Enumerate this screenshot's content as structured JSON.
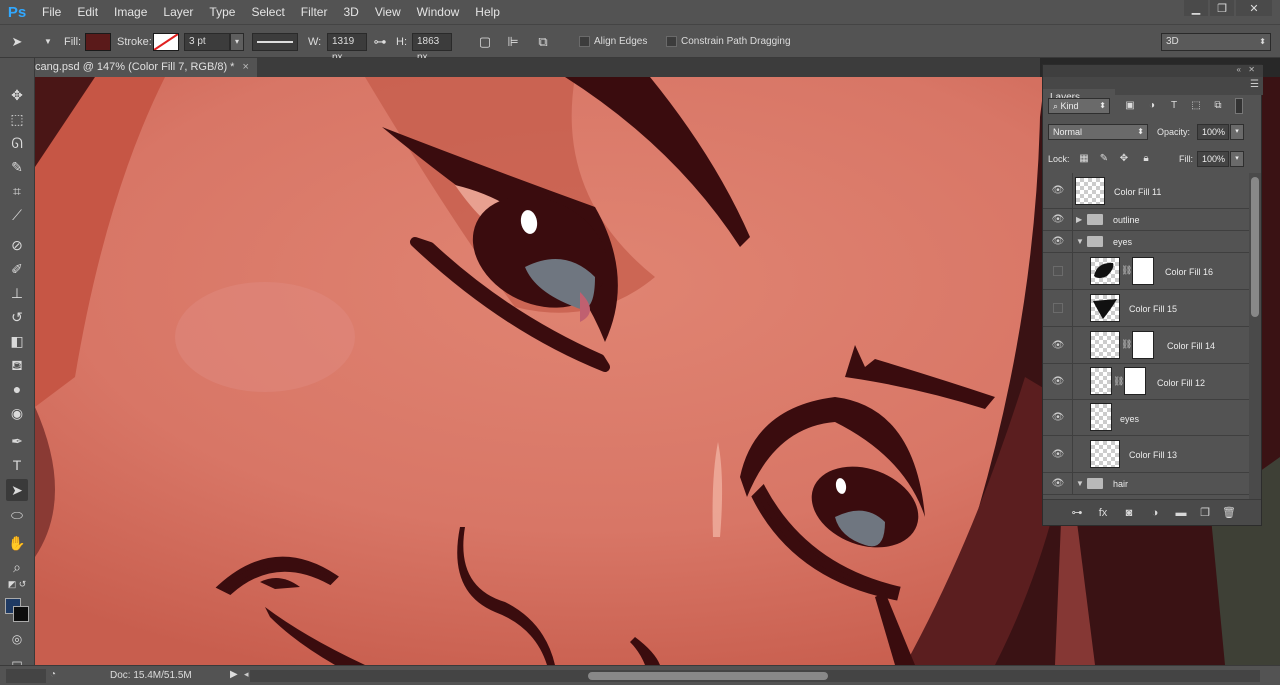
{
  "app": {
    "logo": "Ps"
  },
  "menu": [
    "File",
    "Edit",
    "Image",
    "Layer",
    "Type",
    "Select",
    "Filter",
    "3D",
    "View",
    "Window",
    "Help"
  ],
  "window_controls": {
    "minimize": "▁",
    "restore": "❐",
    "close": "✕"
  },
  "options": {
    "fill_label": "Fill:",
    "fill_color": "#5a1a1a",
    "stroke_label": "Stroke:",
    "stroke_width": "3 pt",
    "w_label": "W:",
    "w_value": "1319 px",
    "h_label": "H:",
    "h_value": "1863 px",
    "align_edges": "Align Edges",
    "constrain": "Constrain Path Dragging",
    "workspace": "3D"
  },
  "document": {
    "tab_title": "cang.psd @ 147% (Color Fill 7, RGB/8) *",
    "close": "×"
  },
  "status": {
    "zoom": "",
    "doc": "Doc: 15.4M/51.5M"
  },
  "colors": {
    "foreground": "#1f3a63",
    "background": "#0d0d0d",
    "accent": "#31a8ff"
  },
  "layers_panel": {
    "tab": "Layers",
    "kind": "Kind",
    "blend_mode": "Normal",
    "opacity_label": "Opacity:",
    "opacity": "100%",
    "lock_label": "Lock:",
    "fill_label": "Fill:",
    "fill": "100%",
    "layers": [
      {
        "name": "Color Fill 11",
        "visible": true,
        "type": "fill"
      },
      {
        "name": "outline",
        "visible": true,
        "type": "group-collapsed"
      },
      {
        "name": "eyes",
        "visible": true,
        "type": "group-open"
      },
      {
        "name": "Color Fill 16",
        "visible": false,
        "type": "fill-mask"
      },
      {
        "name": "Color Fill 15",
        "visible": false,
        "type": "fill"
      },
      {
        "name": "Color Fill 14",
        "visible": true,
        "type": "fill-mask"
      },
      {
        "name": "Color Fill 12",
        "visible": true,
        "type": "fill-mask"
      },
      {
        "name": "eyes",
        "visible": true,
        "type": "fill"
      },
      {
        "name": "Color Fill 13",
        "visible": true,
        "type": "fill"
      },
      {
        "name": "hair",
        "visible": true,
        "type": "group-open"
      }
    ]
  }
}
